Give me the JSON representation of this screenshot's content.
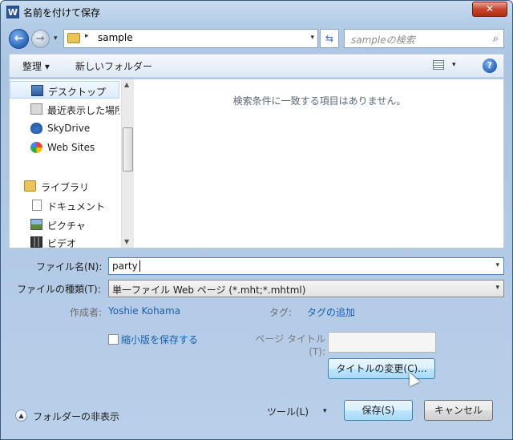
{
  "window": {
    "title": "名前を付けて保存",
    "app_icon": "W",
    "close_glyph": "✕"
  },
  "nav": {
    "back_glyph": "←",
    "forward_glyph": "→",
    "breadcrumb_arrow": "▸",
    "location": "sample",
    "dropdown_glyph": "▾",
    "refresh_glyph": "⇆",
    "search_placeholder": "sampleの検索",
    "search_glyph": "⌕"
  },
  "toolbar": {
    "organize_label": "整理 ▾",
    "new_folder_label": "新しいフォルダー",
    "view_drop_glyph": "▾",
    "help_glyph": "?"
  },
  "sidebar": {
    "items": [
      {
        "label": "デスクトップ",
        "icon": "desktop-icon",
        "selected": true
      },
      {
        "label": "最近表示した場所",
        "icon": "recent-places-icon"
      },
      {
        "label": "SkyDrive",
        "icon": "skydrive-icon"
      },
      {
        "label": "Web Sites",
        "icon": "web-sites-icon"
      },
      {
        "label": "ライブラリ",
        "icon": "libraries-icon"
      },
      {
        "label": "ドキュメント",
        "icon": "documents-icon"
      },
      {
        "label": "ピクチャ",
        "icon": "pictures-icon"
      },
      {
        "label": "ビデオ",
        "icon": "videos-icon"
      }
    ],
    "scroll_up": "▲",
    "scroll_down": "▼"
  },
  "main": {
    "empty_message": "検索条件に一致する項目はありません。"
  },
  "form": {
    "filename_label": "ファイル名(N):",
    "filename_value": "party",
    "filetype_label": "ファイルの種類(T):",
    "filetype_value": "単一ファイル Web ページ (*.mht;*.mhtml)",
    "author_label": "作成者:",
    "author_value": "Yoshie Kohama",
    "tags_label": "タグ:",
    "tags_value": "タグの追加",
    "thumbnail_label": "縮小版を保存する",
    "page_title_label_1": "ページ タイトル",
    "page_title_label_2": "(T):",
    "change_title_button": "タイトルの変更(C)..."
  },
  "footer": {
    "hide_folders_label": "フォルダーの非表示",
    "hide_folders_glyph": "▲",
    "tools_label": "ツール(L)",
    "tools_drop_glyph": "▾",
    "save_button": "保存(S)",
    "cancel_button": "キャンセル"
  }
}
